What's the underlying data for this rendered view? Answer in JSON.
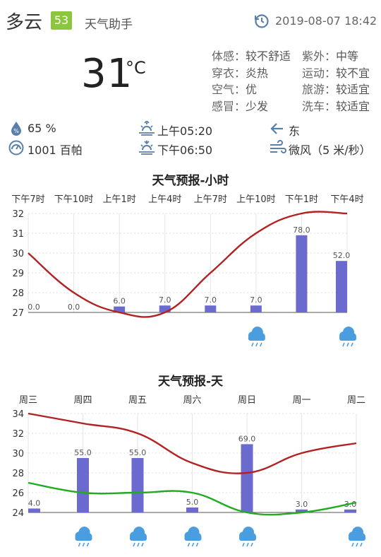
{
  "header": {
    "weather": "多云",
    "aqi": "53",
    "app_name": "天气助手",
    "updated": "2019-08-07 18:42",
    "aqi_color": "#8cc63f"
  },
  "current": {
    "temp": "31",
    "unit": "°C"
  },
  "indices": [
    {
      "label": "体感：",
      "value": "较不舒适"
    },
    {
      "label": "紫外：",
      "value": "中等"
    },
    {
      "label": "穿衣：",
      "value": "炎热"
    },
    {
      "label": "运动：",
      "value": "较不宜"
    },
    {
      "label": "空气：",
      "value": "优"
    },
    {
      "label": "旅游：",
      "value": "较适宜"
    },
    {
      "label": "感冒：",
      "value": "少发"
    },
    {
      "label": "洗车：",
      "value": "较适宜"
    }
  ],
  "details": {
    "humidity": "65 %",
    "pressure": "1001 百帕",
    "sunrise": "上午05:20",
    "sunset": "下午06:50",
    "wind_dir": "东",
    "wind_level": "微风（5 米/秒）"
  },
  "icons": {
    "humidity": "humidity-icon",
    "pressure": "pressure-gauge-icon",
    "sunrise": "sunrise-icon",
    "sunset": "sunset-icon",
    "wind_dir": "arrow-left-icon",
    "wind": "wind-icon",
    "rain": "rain-cloud-icon",
    "clock": "refresh-clock-icon"
  },
  "colors": {
    "bar": "#6a6acf",
    "line_high": "#b22222",
    "line_low": "#22aa22",
    "rain_icon": "#4a9ee0",
    "accent": "#5a7fa8"
  },
  "chart_data": [
    {
      "type": "line",
      "title": "天气预报-小时",
      "categories": [
        "下午7时",
        "下午10时",
        "上午1时",
        "上午4时",
        "上午7时",
        "上午10时",
        "下午1时",
        "下午4时"
      ],
      "series": [
        {
          "type": "line",
          "values": [
            30,
            28,
            27,
            27,
            29,
            31,
            32,
            32
          ]
        },
        {
          "type": "bar",
          "values": [
            0.0,
            0.0,
            6.0,
            7.0,
            7.0,
            7.0,
            78.0,
            52.0
          ]
        }
      ],
      "bar_labels": [
        "0.0",
        "0.0",
        "6.0",
        "7.0",
        "7.0",
        "7.0",
        "78.0",
        "52.0"
      ],
      "ylim": [
        27,
        32
      ],
      "yticks": [
        "27",
        "28",
        "29",
        "30",
        "31",
        "32"
      ],
      "rain": [
        false,
        false,
        false,
        false,
        false,
        true,
        false,
        true
      ],
      "grid": true
    },
    {
      "type": "line",
      "title": "天气预报-天",
      "categories": [
        "周三",
        "周四",
        "周五",
        "周六",
        "周日",
        "周一",
        "周二"
      ],
      "series": [
        {
          "type": "line",
          "values": [
            34,
            33,
            32,
            29,
            28,
            30,
            31
          ]
        },
        {
          "type": "line",
          "values": [
            27,
            26,
            26,
            26,
            24,
            24,
            25
          ]
        },
        {
          "type": "bar",
          "values": [
            4.0,
            55.0,
            55.0,
            5.0,
            69.0,
            3.0,
            3.0
          ]
        }
      ],
      "bar_labels": [
        "4.0",
        "55.0",
        "55.0",
        "5.0",
        "69.0",
        "3.0",
        "3.0"
      ],
      "ylim": [
        24,
        34
      ],
      "yticks": [
        "24",
        "26",
        "28",
        "30",
        "32",
        "34"
      ],
      "rain": [
        false,
        true,
        true,
        true,
        true,
        false,
        true
      ],
      "grid": true
    }
  ]
}
